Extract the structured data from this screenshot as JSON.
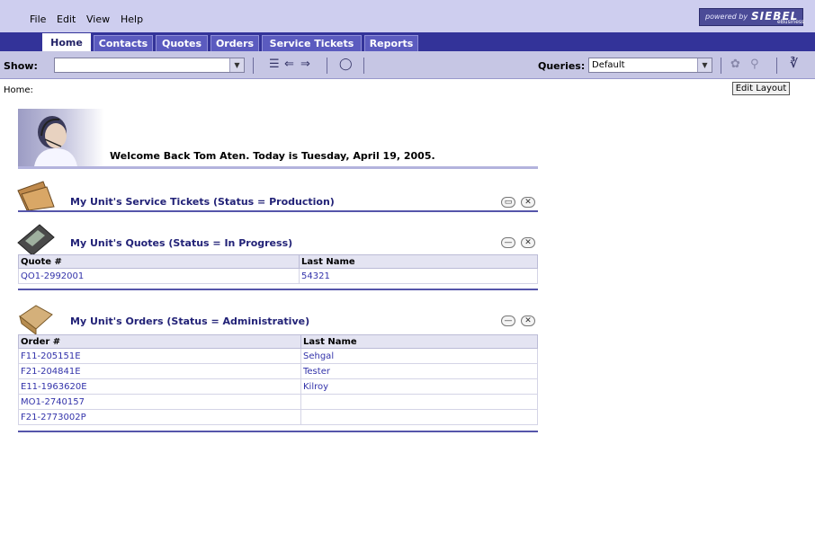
{
  "menubar": {
    "items": [
      "File",
      "Edit",
      "View",
      "Help"
    ],
    "logo": {
      "powered": "powered by",
      "brand": "SIEBEL",
      "sub": "eBusiness"
    }
  },
  "tabs": [
    {
      "label": "Home",
      "active": true
    },
    {
      "label": "Contacts",
      "active": false
    },
    {
      "label": "Quotes",
      "active": false
    },
    {
      "label": "Orders",
      "active": false
    },
    {
      "label": "Service Tickets",
      "active": false
    },
    {
      "label": "Reports",
      "active": false
    }
  ],
  "toolbar": {
    "show_label": "Show:",
    "show_value": "",
    "queries_label": "Queries:",
    "queries_value": "Default",
    "icons": [
      "task-list-icon",
      "back-icon",
      "forward-icon",
      "globe-icon",
      "query-assistant-icon",
      "search-icon",
      "binoculars-icon"
    ]
  },
  "breadcrumb": "Home:",
  "edit_layout_label": "Edit Layout",
  "welcome": {
    "text": "Welcome Back Tom Aten.  Today is Tuesday, April 19, 2005."
  },
  "applets": {
    "service_tickets": {
      "title": "My Unit's Service Tickets (Status = Production)"
    },
    "quotes": {
      "title": "My Unit's Quotes (Status = In Progress)",
      "columns": [
        "Quote #",
        "Last Name"
      ],
      "rows": [
        [
          "QO1-2992001",
          "54321"
        ]
      ]
    },
    "orders": {
      "title": "My Unit's Orders (Status = Administrative)",
      "columns": [
        "Order #",
        "Last Name"
      ],
      "rows": [
        [
          "F11-205151E",
          "Sehgal"
        ],
        [
          "F21-204841E",
          "Tester"
        ],
        [
          "E11-1963620E",
          "Kilroy"
        ],
        [
          "MO1-2740157",
          ""
        ],
        [
          "F21-2773002P",
          ""
        ]
      ]
    }
  },
  "colors": {
    "menubar": "#ceceef",
    "tabstrip": "#333399",
    "tab": "#5b5bbf",
    "link": "#3333aa",
    "rule": "#5555aa"
  }
}
